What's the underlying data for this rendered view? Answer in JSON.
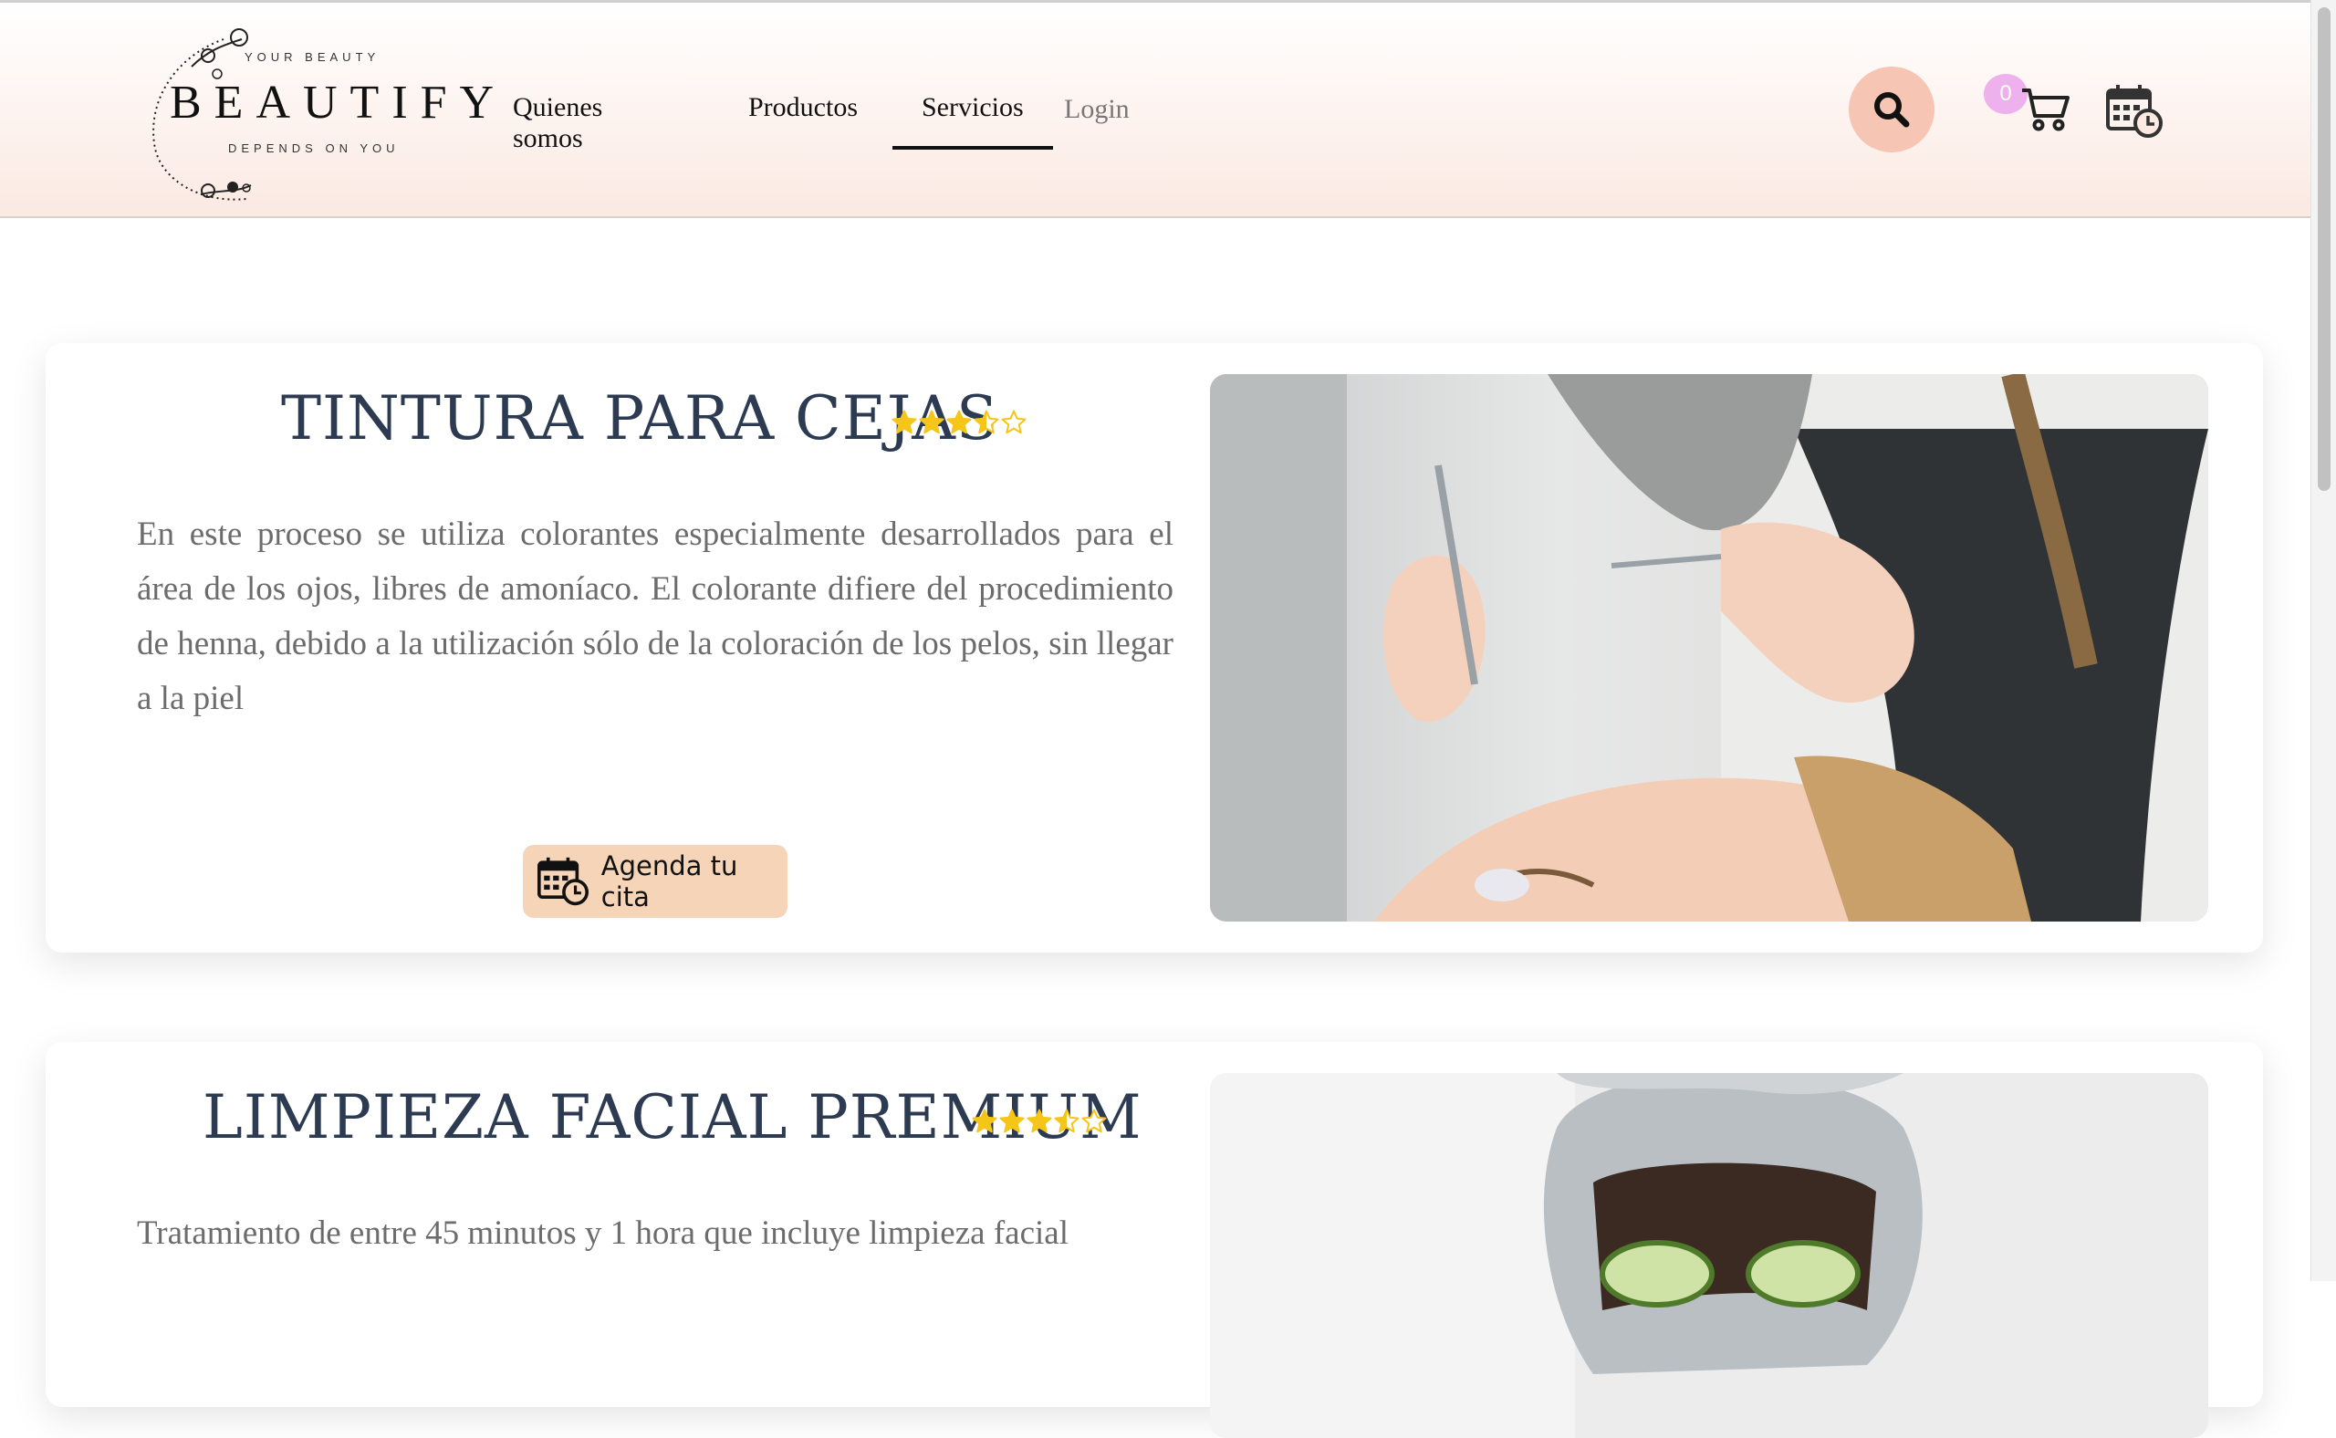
{
  "header": {
    "logo": {
      "top": "YOUR BEAUTY",
      "main": "BEAUTIFY",
      "bottom": "DEPENDS ON YOU"
    },
    "nav": [
      {
        "label": "Quienes somos"
      },
      {
        "label": "Productos"
      },
      {
        "label": "Servicios",
        "active": true
      },
      {
        "label": "Login"
      }
    ],
    "cart_count": "0",
    "icons": [
      "search-icon",
      "cart-icon",
      "calendar-clock-icon"
    ]
  },
  "services": [
    {
      "title": "TINTURA PARA CEJAS",
      "rating": 3.5,
      "description": "En este proceso se utiliza colorantes especialmente desarrollados para el área de los ojos, libres de amoníaco. El colorante difiere del procedimiento de henna, debido a la utilización sólo de la coloración de los pelos, sin llegar a la piel",
      "button": "Agenda tu cita",
      "image_alt": "eyebrow tint treatment photo"
    },
    {
      "title": "LIMPIEZA FACIAL PREMIUM",
      "rating": 3.5,
      "description": "Tratamiento de entre 45 minutos y 1 hora que incluye limpieza facial",
      "image_alt": "facial mask with cucumbers photo"
    }
  ],
  "colors": {
    "header_gradient_end": "#fbe9e2",
    "search_button": "#f6c5b4",
    "badge": "#efb0ee",
    "cta_button": "#f6d4b7",
    "title": "#2c3a52",
    "star": "#f5c518"
  }
}
